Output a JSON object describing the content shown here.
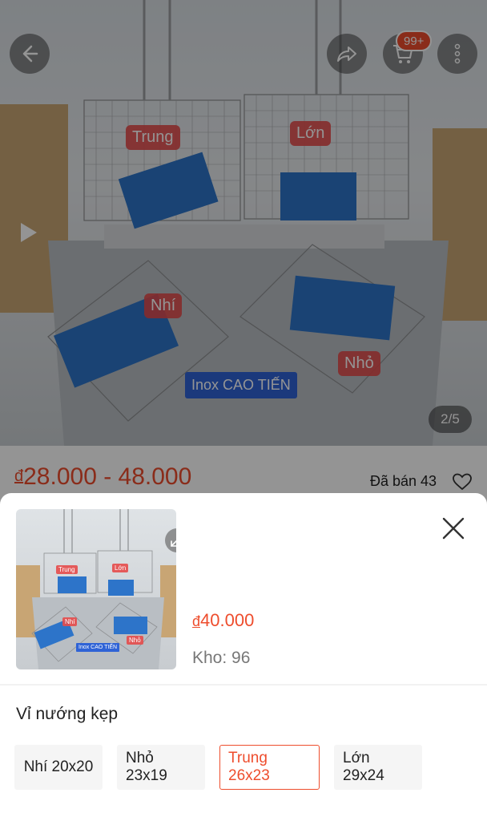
{
  "gallery": {
    "counter": "2/5",
    "photo_labels": {
      "trung": "Trung",
      "lon": "Lớn",
      "nhi": "Nhí",
      "nho": "Nhỏ",
      "brand": "Inox CAO TIẾN"
    },
    "cart_badge": "99+"
  },
  "product": {
    "price_range_currency": "đ",
    "price_range": "28.000 - 48.000",
    "sold": "Đã bán 43"
  },
  "variant_sheet": {
    "thumb_labels": {
      "trung": "Trung",
      "lon": "Lớn",
      "nhi": "Nhí",
      "nho": "Nhỏ",
      "brand": "Inox CAO TIẾN"
    },
    "price_currency": "đ",
    "price": "40.000",
    "stock": "Kho: 96",
    "variation_name": "Vỉ nướng kẹp",
    "options": [
      {
        "label": "Nhí 20x20",
        "selected": false
      },
      {
        "label": "Nhỏ 23x19",
        "selected": false
      },
      {
        "label": "Trung 26x23",
        "selected": true
      },
      {
        "label": "Lớn 29x24",
        "selected": false
      }
    ]
  },
  "colors": {
    "accent": "#ee4d2d",
    "option_bg": "#f5f5f5"
  },
  "icons": [
    "back-arrow-icon",
    "share-icon",
    "cart-icon",
    "more-vertical-icon",
    "play-icon",
    "heart-icon",
    "expand-icon",
    "close-icon"
  ]
}
